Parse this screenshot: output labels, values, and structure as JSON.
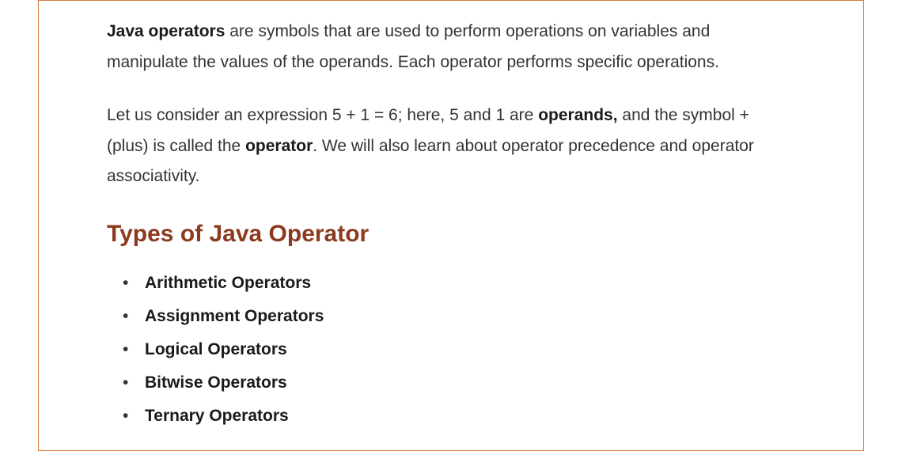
{
  "paragraph1": {
    "bold_lead": "Java operators",
    "text_after_lead": " are symbols that are used to perform operations on variables and manipulate the values of the operands. Each operator performs specific operations."
  },
  "paragraph2": {
    "part1": " Let us consider an expression 5 + 1 = 6; here, 5 and 1 are ",
    "bold1": "operands,",
    "part2": " and the symbol + (plus) is called the ",
    "bold2": "operator",
    "part3": ". We will also learn about operator precedence and operator associativity."
  },
  "heading": "Types of Java Operator",
  "list_items": [
    "Arithmetic Operators",
    "Assignment Operators",
    "Logical Operators",
    "Bitwise Operators",
    "Ternary Operators"
  ]
}
